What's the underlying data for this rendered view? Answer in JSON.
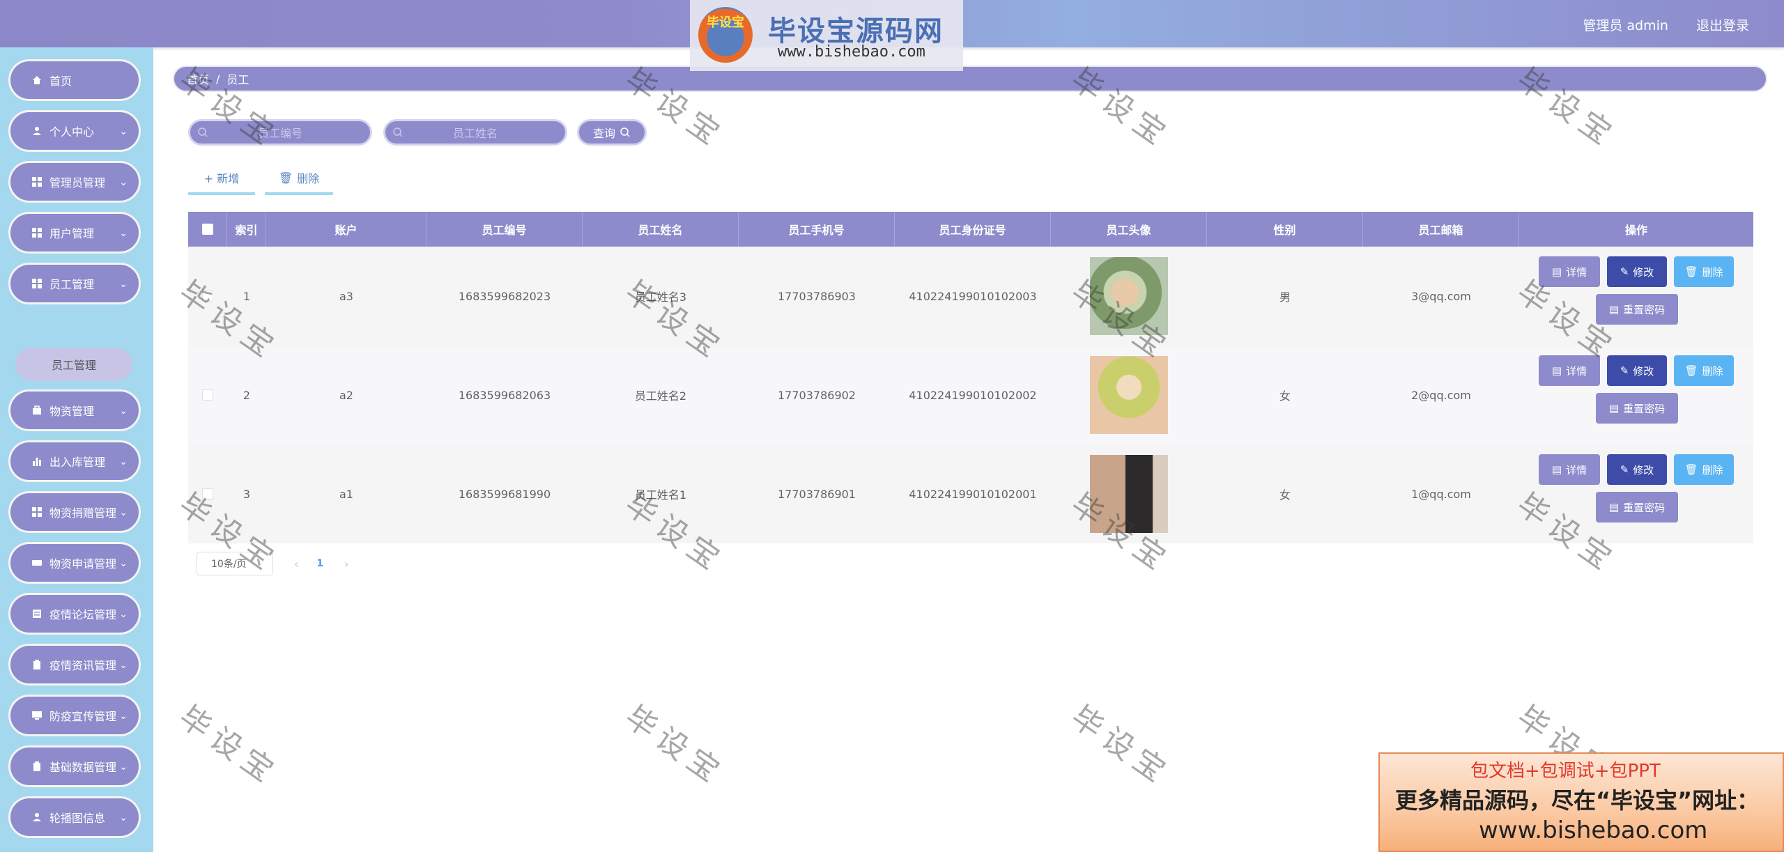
{
  "header": {
    "logo_emblem": "毕设宝",
    "logo_title": "毕设宝源码网",
    "logo_url": "www.bishebao.com",
    "user_label": "管理员 admin",
    "logout_label": "退出登录"
  },
  "sidebar": {
    "items": [
      {
        "label": "首页",
        "icon": "home-icon"
      },
      {
        "label": "个人中心",
        "icon": "user-icon"
      },
      {
        "label": "管理员管理",
        "icon": "grid-icon"
      },
      {
        "label": "用户管理",
        "icon": "grid-icon"
      },
      {
        "label": "员工管理",
        "icon": "grid-icon"
      },
      {
        "label": "物资管理",
        "icon": "box-icon"
      },
      {
        "label": "出入库管理",
        "icon": "chart-icon"
      },
      {
        "label": "物资捐赠管理",
        "icon": "grid-icon"
      },
      {
        "label": "物资申请管理",
        "icon": "ticket-icon"
      },
      {
        "label": "疫情论坛管理",
        "icon": "doc-icon"
      },
      {
        "label": "疫情资讯管理",
        "icon": "clipboard-icon"
      },
      {
        "label": "防疫宣传管理",
        "icon": "monitor-icon"
      },
      {
        "label": "基础数据管理",
        "icon": "clipboard-icon"
      },
      {
        "label": "轮播图信息",
        "icon": "user-icon"
      }
    ],
    "active_sub": "员工管理"
  },
  "breadcrumb": {
    "home": "首页",
    "sep": "/",
    "current": "员工"
  },
  "search": {
    "employee_no_placeholder": "员工编号",
    "employee_name_placeholder": "员工姓名",
    "query_label": "查询"
  },
  "actions": {
    "add_label": "+ 新增",
    "delete_label": "删除"
  },
  "table": {
    "columns": [
      "索引",
      "账户",
      "员工编号",
      "员工姓名",
      "员工手机号",
      "员工身份证号",
      "员工头像",
      "性别",
      "员工邮箱",
      "操作"
    ],
    "rows": [
      {
        "index": "1",
        "account": "a3",
        "no": "1683599682023",
        "name": "员工姓名3",
        "phone": "17703786903",
        "id_card": "410224199010102003",
        "gender": "男",
        "email": "3@qq.com"
      },
      {
        "index": "2",
        "account": "a2",
        "no": "1683599682063",
        "name": "员工姓名2",
        "phone": "17703786902",
        "id_card": "410224199010102002",
        "gender": "女",
        "email": "2@qq.com"
      },
      {
        "index": "3",
        "account": "a1",
        "no": "1683599681990",
        "name": "员工姓名1",
        "phone": "17703786901",
        "id_card": "410224199010102001",
        "gender": "女",
        "email": "1@qq.com"
      }
    ],
    "op_labels": {
      "detail": "详情",
      "edit": "修改",
      "delete": "删除",
      "reset_password": "重置密码"
    }
  },
  "pager": {
    "page_size": "10条/页",
    "prev": "‹",
    "current": "1",
    "next": "›"
  },
  "watermark_text": "毕设宝",
  "ad": {
    "line1": "包文档+包调试+包PPT",
    "line2": "更多精品源码，尽在“毕设宝”网址：",
    "line3": "www.bishebao.com"
  },
  "colors": {
    "primary": "#8d8bcb",
    "sidebar_bg": "#a3d8ef",
    "edit_btn": "#3c4ca8",
    "delete_btn": "#5ab4f3"
  }
}
